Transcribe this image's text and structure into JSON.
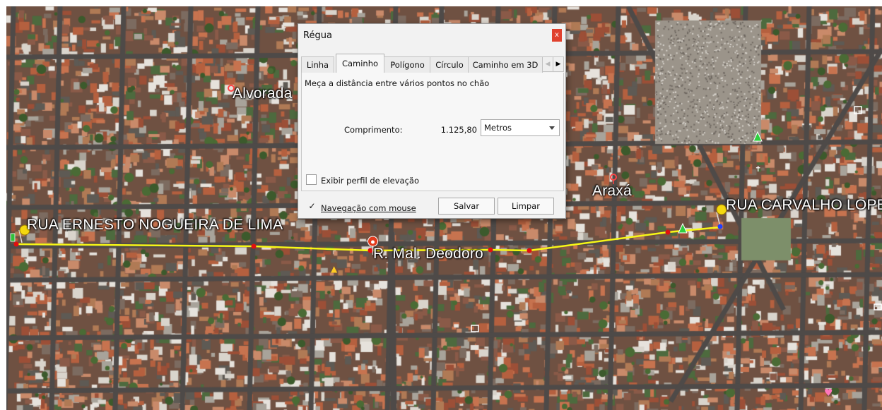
{
  "map": {
    "labels": {
      "alvorada": "Alvorada",
      "araxa": "Araxá",
      "rua_ernesto": "RUA ERNESTO NOGUEIRA DE LIMA",
      "mal_deodoro": "R. Mal. Deodoro",
      "rua_carvalho": "RUA CARVALHO LOPES"
    },
    "path_color": "#f7f716",
    "vertex_color": "#e01010",
    "pin_color": "#f5d80f"
  },
  "dialog": {
    "title": "Régua",
    "close_glyph": "x",
    "tabs": [
      "Linha",
      "Caminho",
      "Polígono",
      "Círculo",
      "Caminho em 3D"
    ],
    "active_tab": "Caminho",
    "tab_scroll_left": "◀",
    "tab_scroll_right": "▶",
    "description": "Meça a distância entre vários pontos no chão",
    "length_label": "Comprimento:",
    "length_value": "1.125,80",
    "unit": "Metros",
    "elevation_label": "Exibir perfil de elevação",
    "elevation_checked": false,
    "mouse_nav_label": "Navegação com mouse",
    "mouse_nav_check": "✓",
    "mouse_nav_checked": true,
    "save_label": "Salvar",
    "clear_label": "Limpar"
  }
}
